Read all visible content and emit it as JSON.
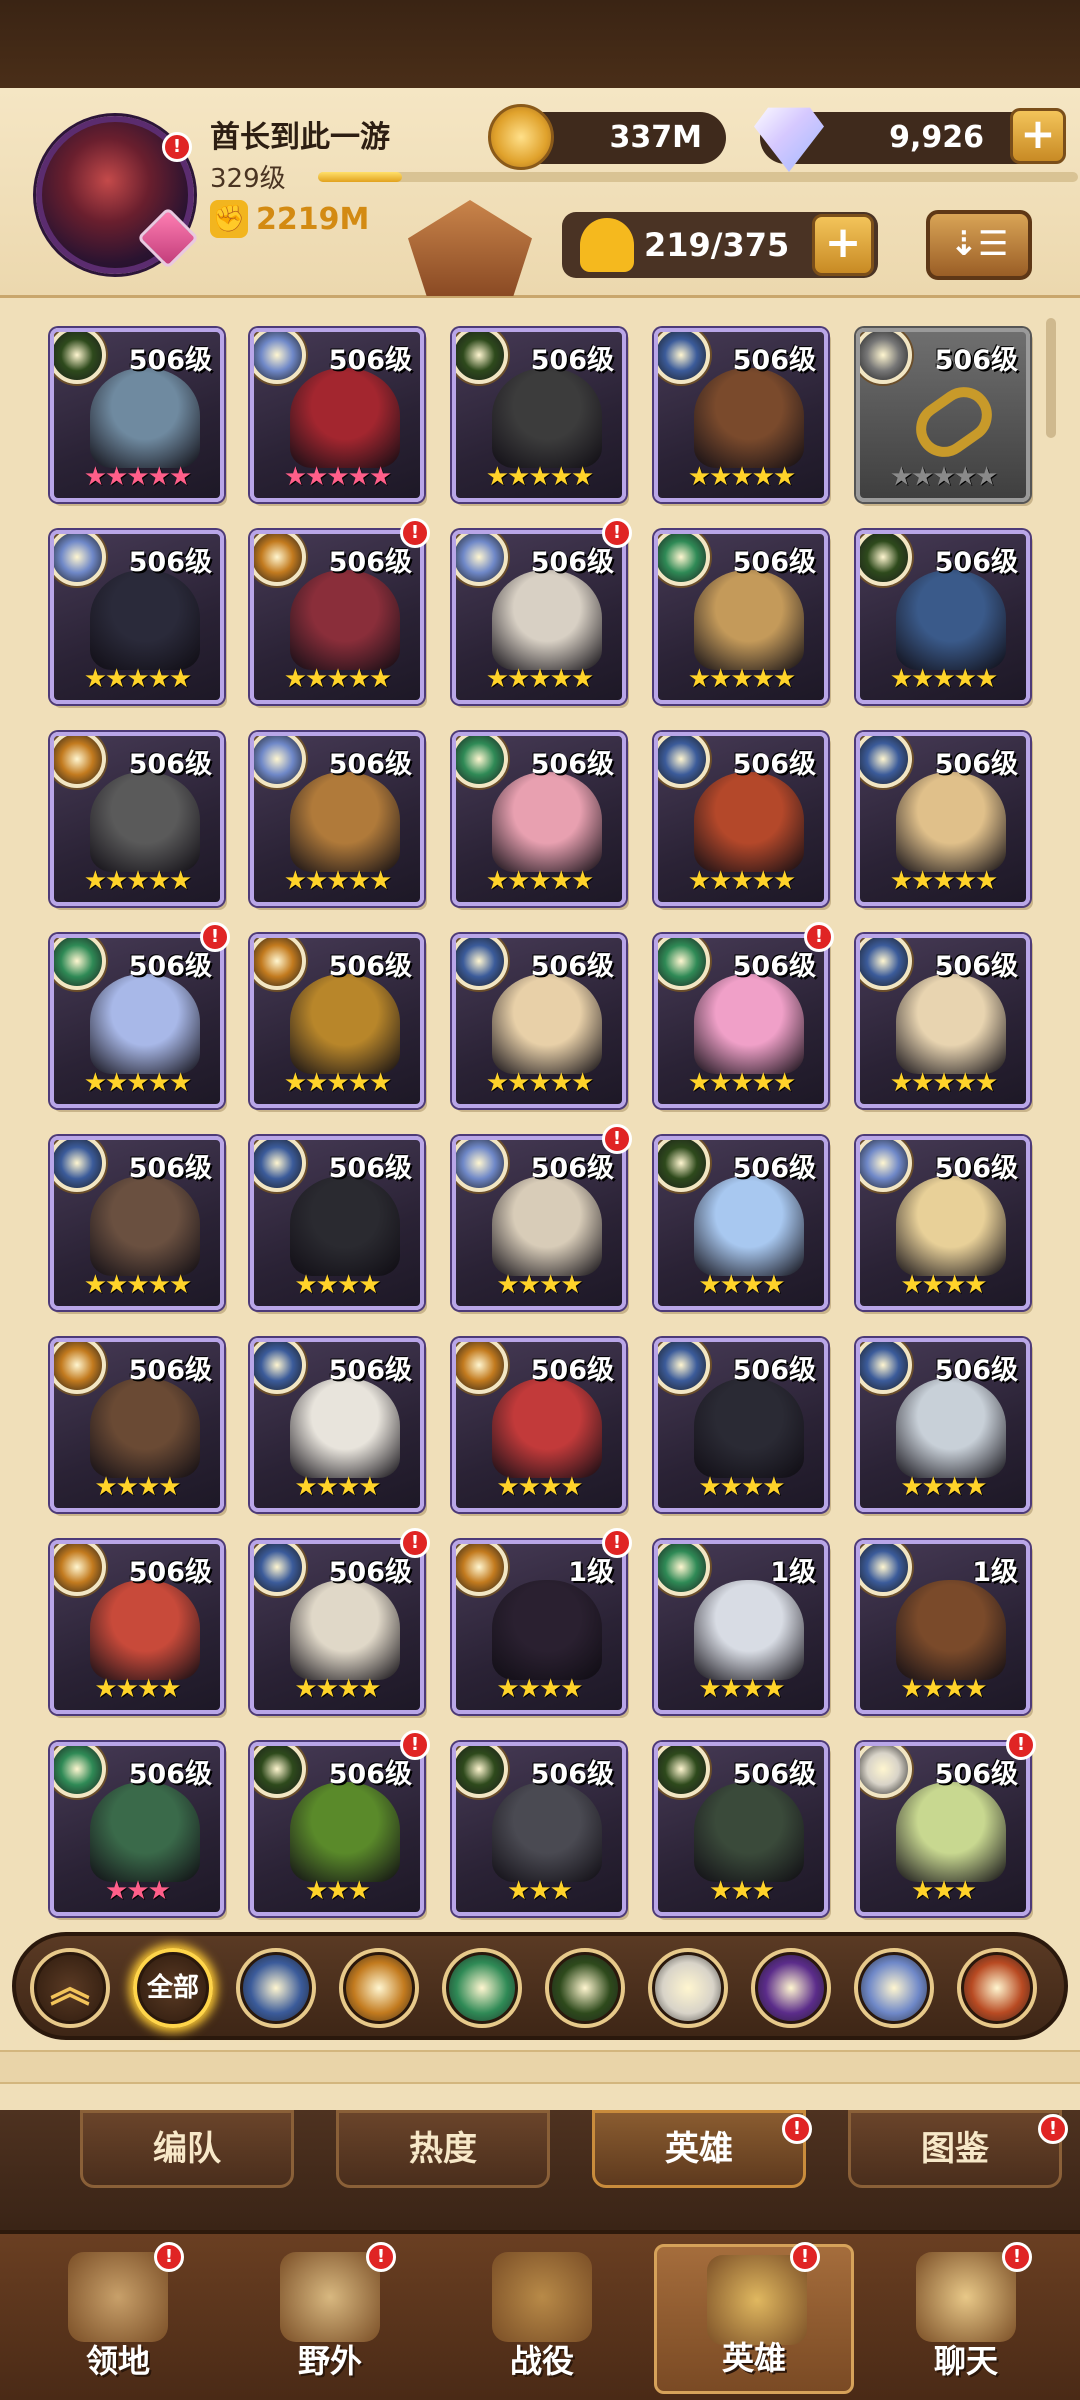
{
  "player": {
    "name": "酋长到此一游",
    "level": "329级",
    "power": "2219M"
  },
  "currencies": {
    "gold": "337M",
    "gems": "9,926",
    "gems_plus": "+"
  },
  "hero_count": {
    "text": "219/375",
    "plus": "+"
  },
  "sort_label": "⇣☰",
  "colors": {
    "faction_lightbearer": "#3b5b9a",
    "faction_mauler": "#c27a1e",
    "faction_wilder": "#2f8a56",
    "faction_graveborn": "#2e4a1c",
    "faction_celestial": "#d8d3c8",
    "faction_hypogean": "#5b2c8a",
    "faction_dimensional": "#6f88c8",
    "faction_dragon": "#b84a22"
  },
  "heroes": [
    {
      "level": "506级",
      "stars": "★★★★★",
      "star_color": "pink",
      "faction": "graveborn",
      "tint": "#6f8aa0",
      "notify": false,
      "locked": false
    },
    {
      "level": "506级",
      "stars": "★★★★★",
      "star_color": "pink",
      "faction": "dimensional",
      "tint": "#a3262f",
      "notify": false,
      "locked": false
    },
    {
      "level": "506级",
      "stars": "★★★★★",
      "star_color": "gold",
      "faction": "graveborn",
      "tint": "#3c3c3c",
      "notify": false,
      "locked": false
    },
    {
      "level": "506级",
      "stars": "★★★★★",
      "star_color": "gold",
      "faction": "lightbearer",
      "tint": "#7a4a2c",
      "notify": false,
      "locked": false
    },
    {
      "level": "506级",
      "stars": "★★★★★",
      "star_color": "grey",
      "faction": "locked",
      "tint": "#c89a2a",
      "notify": false,
      "locked": true
    },
    {
      "level": "506级",
      "stars": "★★★★★",
      "star_color": "gold",
      "faction": "dimensional",
      "tint": "#2a2a3a",
      "notify": false,
      "locked": false
    },
    {
      "level": "506级",
      "stars": "★★★★★",
      "star_color": "gold",
      "faction": "mauler",
      "tint": "#8a2e3a",
      "notify": true,
      "locked": false
    },
    {
      "level": "506级",
      "stars": "★★★★★",
      "star_color": "gold",
      "faction": "dimensional",
      "tint": "#d8d0c4",
      "notify": true,
      "locked": false
    },
    {
      "level": "506级",
      "stars": "★★★★★",
      "star_color": "gold",
      "faction": "wilder",
      "tint": "#c49a5a",
      "notify": false,
      "locked": false
    },
    {
      "level": "506级",
      "stars": "★★★★★",
      "star_color": "gold",
      "faction": "graveborn",
      "tint": "#3a5a8a",
      "notify": false,
      "locked": false
    },
    {
      "level": "506级",
      "stars": "★★★★★",
      "star_color": "gold",
      "faction": "mauler",
      "tint": "#5a5a5a",
      "notify": false,
      "locked": false
    },
    {
      "level": "506级",
      "stars": "★★★★★",
      "star_color": "gold",
      "faction": "dimensional",
      "tint": "#b07a3a",
      "notify": false,
      "locked": false
    },
    {
      "level": "506级",
      "stars": "★★★★★",
      "star_color": "gold",
      "faction": "wilder",
      "tint": "#e8a0b0",
      "notify": false,
      "locked": false
    },
    {
      "level": "506级",
      "stars": "★★★★★",
      "star_color": "gold",
      "faction": "lightbearer",
      "tint": "#b4482a",
      "notify": false,
      "locked": false
    },
    {
      "level": "506级",
      "stars": "★★★★★",
      "star_color": "gold",
      "faction": "lightbearer",
      "tint": "#e0c08a",
      "notify": false,
      "locked": false
    },
    {
      "level": "506级",
      "stars": "★★★★★",
      "star_color": "gold",
      "faction": "wilder",
      "tint": "#a8b8e8",
      "notify": true,
      "locked": false
    },
    {
      "level": "506级",
      "stars": "★★★★★",
      "star_color": "gold",
      "faction": "mauler",
      "tint": "#b8862a",
      "notify": false,
      "locked": false
    },
    {
      "level": "506级",
      "stars": "★★★★★",
      "star_color": "gold",
      "faction": "lightbearer",
      "tint": "#e8d0a8",
      "notify": false,
      "locked": false
    },
    {
      "level": "506级",
      "stars": "★★★★★",
      "star_color": "gold",
      "faction": "wilder",
      "tint": "#f0a0c8",
      "notify": true,
      "locked": false
    },
    {
      "level": "506级",
      "stars": "★★★★★",
      "star_color": "gold",
      "faction": "lightbearer",
      "tint": "#e8d4b0",
      "notify": false,
      "locked": false
    },
    {
      "level": "506级",
      "stars": "★★★★★",
      "star_color": "gold",
      "faction": "lightbearer",
      "tint": "#6a5040",
      "notify": false,
      "locked": false
    },
    {
      "level": "506级",
      "stars": "★★★★",
      "star_color": "gold",
      "faction": "lightbearer",
      "tint": "#2a2a30",
      "notify": false,
      "locked": false
    },
    {
      "level": "506级",
      "stars": "★★★★",
      "star_color": "gold",
      "faction": "dimensional",
      "tint": "#d8ccb8",
      "notify": true,
      "locked": false
    },
    {
      "level": "506级",
      "stars": "★★★★",
      "star_color": "gold",
      "faction": "graveborn",
      "tint": "#a8c8f0",
      "notify": false,
      "locked": false
    },
    {
      "level": "506级",
      "stars": "★★★★",
      "star_color": "gold",
      "faction": "dimensional",
      "tint": "#e8d098",
      "notify": false,
      "locked": false
    },
    {
      "level": "506级",
      "stars": "★★★★",
      "star_color": "gold",
      "faction": "mauler",
      "tint": "#6a4a34",
      "notify": false,
      "locked": false
    },
    {
      "level": "506级",
      "stars": "★★★★",
      "star_color": "gold",
      "faction": "lightbearer",
      "tint": "#e8e4dc",
      "notify": false,
      "locked": false
    },
    {
      "level": "506级",
      "stars": "★★★★",
      "star_color": "gold",
      "faction": "mauler",
      "tint": "#c23a3a",
      "notify": false,
      "locked": false
    },
    {
      "level": "506级",
      "stars": "★★★★",
      "star_color": "gold",
      "faction": "lightbearer",
      "tint": "#2a2a34",
      "notify": false,
      "locked": false
    },
    {
      "level": "506级",
      "stars": "★★★★",
      "star_color": "gold",
      "faction": "lightbearer",
      "tint": "#c8d0d8",
      "notify": false,
      "locked": false
    },
    {
      "level": "506级",
      "stars": "★★★★",
      "star_color": "gold",
      "faction": "mauler",
      "tint": "#c84a3a",
      "notify": false,
      "locked": false
    },
    {
      "level": "506级",
      "stars": "★★★★",
      "star_color": "gold",
      "faction": "lightbearer",
      "tint": "#e0d8c8",
      "notify": true,
      "locked": false
    },
    {
      "level": "1级",
      "stars": "★★★★",
      "star_color": "gold",
      "faction": "mauler",
      "tint": "#2a2030",
      "notify": true,
      "locked": false
    },
    {
      "level": "1级",
      "stars": "★★★★",
      "star_color": "gold",
      "faction": "wilder",
      "tint": "#d8dce4",
      "notify": false,
      "locked": false
    },
    {
      "level": "1级",
      "stars": "★★★★",
      "star_color": "gold",
      "faction": "lightbearer",
      "tint": "#7a4a2a",
      "notify": false,
      "locked": false
    },
    {
      "level": "506级",
      "stars": "★★★",
      "star_color": "pink",
      "faction": "wilder",
      "tint": "#3a6a4a",
      "notify": false,
      "locked": false
    },
    {
      "level": "506级",
      "stars": "★★★",
      "star_color": "gold",
      "faction": "graveborn",
      "tint": "#5a8a2a",
      "notify": true,
      "locked": false
    },
    {
      "level": "506级",
      "stars": "★★★",
      "star_color": "gold",
      "faction": "graveborn",
      "tint": "#4a4a52",
      "notify": false,
      "locked": false
    },
    {
      "level": "506级",
      "stars": "★★★",
      "star_color": "gold",
      "faction": "graveborn",
      "tint": "#3a4a3a",
      "notify": false,
      "locked": false
    },
    {
      "level": "506级",
      "stars": "★★★",
      "star_color": "gold",
      "faction": "celestial",
      "tint": "#c8d890",
      "notify": true,
      "locked": false
    }
  ],
  "filters": [
    {
      "name": "collapse",
      "label": "︽",
      "color": "#3e2616"
    },
    {
      "name": "all",
      "label": "全部",
      "color": "#3e2616"
    },
    {
      "name": "lightbearer",
      "label": "",
      "color": "#3b5b9a"
    },
    {
      "name": "mauler",
      "label": "",
      "color": "#c27a1e"
    },
    {
      "name": "wilder",
      "label": "",
      "color": "#2f8a56"
    },
    {
      "name": "graveborn",
      "label": "",
      "color": "#2e4a1c"
    },
    {
      "name": "celestial",
      "label": "",
      "color": "#d8d3c8"
    },
    {
      "name": "hypogean",
      "label": "",
      "color": "#5b2c8a"
    },
    {
      "name": "dimensional",
      "label": "",
      "color": "#6f88c8"
    },
    {
      "name": "dragon",
      "label": "",
      "color": "#b84a22"
    }
  ],
  "subtabs": [
    {
      "label": "编队",
      "notify": false,
      "active": false
    },
    {
      "label": "热度",
      "notify": false,
      "active": false
    },
    {
      "label": "英雄",
      "notify": true,
      "active": true
    },
    {
      "label": "图鉴",
      "notify": true,
      "active": false
    }
  ],
  "nav": [
    {
      "label": "领地",
      "notify": true,
      "active": false,
      "icon": "castle-icon",
      "color": "#c8a06a"
    },
    {
      "label": "野外",
      "notify": true,
      "active": false,
      "icon": "map-icon",
      "color": "#d8b880"
    },
    {
      "label": "战役",
      "notify": false,
      "active": false,
      "icon": "sword-icon",
      "color": "#b88a48"
    },
    {
      "label": "英雄",
      "notify": true,
      "active": true,
      "icon": "helmet-icon",
      "color": "#e0b860"
    },
    {
      "label": "聊天",
      "notify": true,
      "active": false,
      "icon": "chat-icon",
      "color": "#e8c888"
    }
  ],
  "notify_mark": "!"
}
